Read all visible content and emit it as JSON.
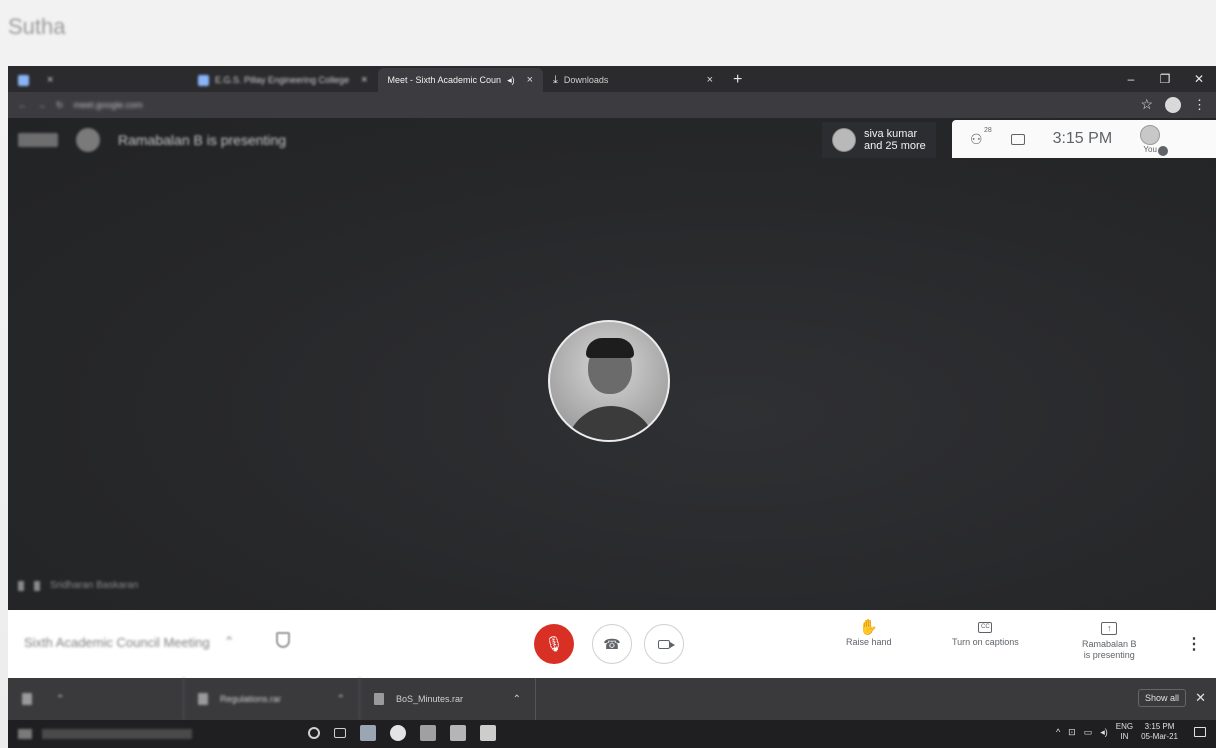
{
  "photo_caption": "Sutha",
  "browser": {
    "tabs": [
      {
        "title": "",
        "blurred": true
      },
      {
        "title": "E.G.S. Pillay Engineering College",
        "blurred": true
      },
      {
        "title": "Meet - Sixth Academic Coun",
        "active": true
      },
      {
        "title": "Downloads"
      }
    ],
    "address": "meet.google.com"
  },
  "meet": {
    "presenting_banner": "Ramabalan B is presenting",
    "participants_chip": {
      "line1": "siva kumar",
      "line2": "and 25 more"
    },
    "participant_count": "28",
    "clock": "3:15 PM",
    "you_label": "You",
    "self_tile_label": "Sridharan Baskaran",
    "meeting_title": "Sixth Academic Council Meeting",
    "controls": {
      "raise_hand": "Raise hand",
      "captions": "Turn on captions",
      "presenting_line1": "Ramabalan B",
      "presenting_line2": "is presenting"
    }
  },
  "downloads_bar": {
    "items": [
      "",
      "Regulations.rar",
      "BoS_Minutes.rar"
    ],
    "show_all": "Show all"
  },
  "taskbar": {
    "lang_top": "ENG",
    "lang_bottom": "IN",
    "time": "3:15 PM",
    "date": "05-Mar-21"
  },
  "colors": {
    "meet_bg": "#262729",
    "mic_off_red": "#d93025",
    "panel_white": "#ffffff"
  }
}
